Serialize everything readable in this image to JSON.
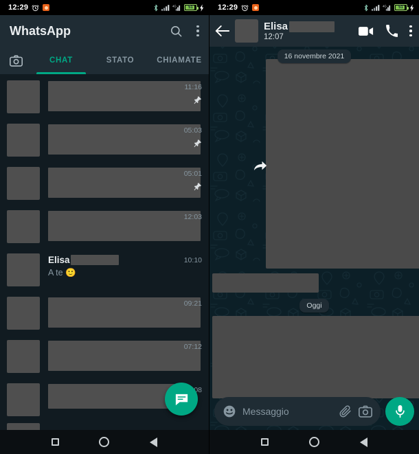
{
  "status_bar": {
    "time": "12:29",
    "icons": [
      "alarm-icon",
      "app-notification-icon",
      "bluetooth-icon",
      "signal-icon",
      "signal-2-icon",
      "battery-charging-icon"
    ],
    "battery_label": "51"
  },
  "colors": {
    "accent": "#00a884",
    "appbar": "#1f2c34",
    "list_bg": "#111b21",
    "wallpaper": "#0c1f27",
    "redaction": "#4f4f4f",
    "text_primary": "#e9edef",
    "text_secondary": "#8696a0"
  },
  "left_panel": {
    "app_title": "WhatsApp",
    "actions": {
      "search": "search-icon",
      "overflow": "more-options-icon"
    },
    "tabs": [
      {
        "label": "",
        "name": "tab-camera",
        "active": false
      },
      {
        "label": "CHAT",
        "name": "tab-chat",
        "active": true
      },
      {
        "label": "STATO",
        "name": "tab-stato",
        "active": false
      },
      {
        "label": "CHIAMATE",
        "name": "tab-chiamate",
        "active": false
      }
    ],
    "chats": [
      {
        "name": "",
        "redacted_name": true,
        "preview": "",
        "redacted_preview": true,
        "time": "11:16",
        "pinned": true
      },
      {
        "name": "",
        "redacted_name": true,
        "preview": "",
        "redacted_preview": true,
        "time": "05:03",
        "pinned": true
      },
      {
        "name": "",
        "redacted_name": true,
        "preview": "",
        "redacted_preview": true,
        "time": "05:01",
        "pinned": true
      },
      {
        "name": "",
        "redacted_name": true,
        "preview": "",
        "redacted_preview": true,
        "time": "12:03",
        "pinned": false
      },
      {
        "name": "Elisa",
        "redacted_name": true,
        "preview": "A te 🙂",
        "redacted_preview": false,
        "time": "10:10",
        "pinned": false
      },
      {
        "name": "",
        "redacted_name": true,
        "preview": "",
        "redacted_preview": true,
        "time": "09:21",
        "pinned": false
      },
      {
        "name": "",
        "redacted_name": true,
        "preview": "",
        "redacted_preview": true,
        "time": "07:12",
        "pinned": false
      },
      {
        "name": "",
        "redacted_name": true,
        "preview": "",
        "redacted_preview": true,
        "time": "08",
        "pinned": false
      }
    ],
    "fab": "new-chat-icon"
  },
  "right_panel": {
    "back": "back-arrow-icon",
    "contact_name": "Elisa",
    "contact_status": "12:07",
    "actions": {
      "video_call": "video-call-icon",
      "voice_call": "phone-call-icon",
      "overflow": "more-options-icon"
    },
    "date_chips": [
      "16 novembre 2021",
      "Oggi"
    ],
    "forwarded_marker": "forward-arrow-icon",
    "composer": {
      "emoji": "emoji-icon",
      "placeholder": "Messaggio",
      "attach": "attachment-icon",
      "camera": "camera-icon",
      "mic": "microphone-icon"
    }
  },
  "nav_bar": {
    "recents": "recents-square-icon",
    "home": "home-circle-icon",
    "back": "back-triangle-icon"
  }
}
